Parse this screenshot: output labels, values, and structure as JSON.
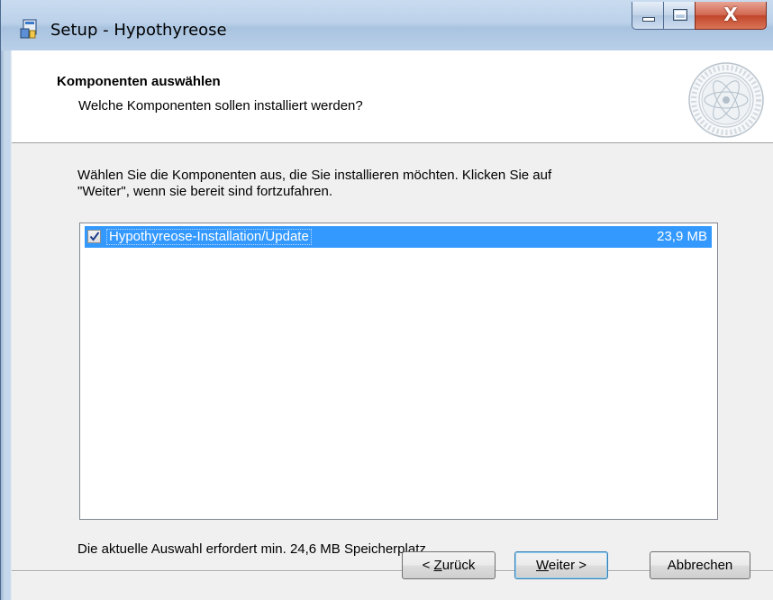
{
  "window": {
    "title": "Setup - Hypothyreose",
    "close_glyph": "X"
  },
  "header": {
    "title": "Komponenten auswählen",
    "subtitle": "Welche Komponenten sollen installiert werden?"
  },
  "body": {
    "instruction_line1": "Wählen Sie die Komponenten aus, die Sie installieren möchten. Klicken Sie auf",
    "instruction_line2": "\"Weiter\", wenn sie bereit sind fortzufahren."
  },
  "components": [
    {
      "label": "Hypothyreose-Installation/Update",
      "size": "23,9 MB",
      "checked": true
    }
  ],
  "status": "Die aktuelle Auswahl erfordert min. 24,6 MB Speicherplatz.",
  "buttons": {
    "back_prefix": "< ",
    "back_accel": "Z",
    "back_rest": "urück",
    "next_accel": "W",
    "next_rest": "eiter >",
    "cancel": "Abbrechen"
  },
  "colors": {
    "selection": "#3399ff",
    "dialog_bg": "#f0f0f0"
  },
  "icons": {
    "app": "setup-icon",
    "seal": "university-seal-icon"
  }
}
